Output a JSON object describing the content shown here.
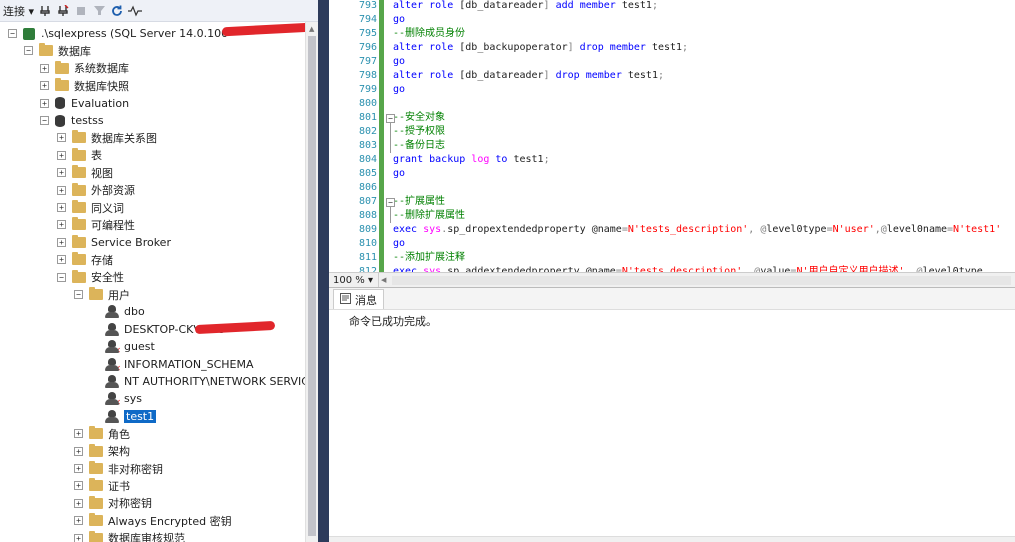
{
  "object_explorer": {
    "toolbar": {
      "connect_label": "连接 ▾"
    },
    "tree": [
      {
        "label": ".\\sqlexpress (SQL Server 14.0.100",
        "icon": "server-icon"
      },
      {
        "label": "数据库",
        "icon": "folder-icon"
      },
      {
        "label": "系统数据库",
        "icon": "folder-icon"
      },
      {
        "label": "数据库快照",
        "icon": "folder-icon"
      },
      {
        "label": "Evaluation",
        "icon": "database-icon"
      },
      {
        "label": "testss",
        "icon": "database-icon"
      },
      {
        "label": "数据库关系图",
        "icon": "folder-icon"
      },
      {
        "label": "表",
        "icon": "folder-icon"
      },
      {
        "label": "视图",
        "icon": "folder-icon"
      },
      {
        "label": "外部资源",
        "icon": "folder-icon"
      },
      {
        "label": "同义词",
        "icon": "folder-icon"
      },
      {
        "label": "可编程性",
        "icon": "folder-icon"
      },
      {
        "label": "Service Broker",
        "icon": "folder-icon"
      },
      {
        "label": "存储",
        "icon": "folder-icon"
      },
      {
        "label": "安全性",
        "icon": "folder-icon"
      },
      {
        "label": "用户",
        "icon": "folder-icon"
      },
      {
        "label": "dbo",
        "icon": "user-icon"
      },
      {
        "label": "DESKTOP-CKVMU9",
        "icon": "user-icon"
      },
      {
        "label": "guest",
        "icon": "user-disabled-icon"
      },
      {
        "label": "INFORMATION_SCHEMA",
        "icon": "user-disabled-icon"
      },
      {
        "label": "NT AUTHORITY\\NETWORK SERVICE",
        "icon": "user-icon"
      },
      {
        "label": "sys",
        "icon": "user-disabled-icon"
      },
      {
        "label": "test1",
        "icon": "user-icon"
      },
      {
        "label": "角色",
        "icon": "folder-icon"
      },
      {
        "label": "架构",
        "icon": "folder-icon"
      },
      {
        "label": "非对称密钥",
        "icon": "folder-icon"
      },
      {
        "label": "证书",
        "icon": "folder-icon"
      },
      {
        "label": "对称密钥",
        "icon": "folder-icon"
      },
      {
        "label": "Always Encrypted 密钥",
        "icon": "folder-icon"
      },
      {
        "label": "数据库审核规范",
        "icon": "folder-icon"
      }
    ]
  },
  "editor": {
    "lines": [
      {
        "num": "793",
        "text": "alter role [db_datareader] add member test1;"
      },
      {
        "num": "794",
        "text": "go"
      },
      {
        "num": "795",
        "text": "--删除成员身份"
      },
      {
        "num": "796",
        "text": "alter role [db_backupoperator] drop member test1;"
      },
      {
        "num": "797",
        "text": "go"
      },
      {
        "num": "798",
        "text": "alter role [db_datareader] drop member test1;"
      },
      {
        "num": "799",
        "text": "go"
      },
      {
        "num": "800",
        "text": ""
      },
      {
        "num": "801",
        "text": "--安全对象"
      },
      {
        "num": "802",
        "text": "--授予权限"
      },
      {
        "num": "803",
        "text": "--备份日志"
      },
      {
        "num": "804",
        "text": "grant backup log to test1;"
      },
      {
        "num": "805",
        "text": "go"
      },
      {
        "num": "806",
        "text": ""
      },
      {
        "num": "807",
        "text": "--扩展属性"
      },
      {
        "num": "808",
        "text": "--删除扩展属性"
      },
      {
        "num": "809",
        "text": "exec sys.sp_dropextendedproperty @name=N'tests_description', @level0type=N'user',@level0name=N'test1'"
      },
      {
        "num": "810",
        "text": "go"
      },
      {
        "num": "811",
        "text": "--添加扩展注释"
      },
      {
        "num": "812",
        "text": "exec sys.sp_addextendedproperty @name=N'tests_description', @value=N'用户自定义用户描述', @level0type"
      }
    ],
    "zoom": "100 %"
  },
  "results": {
    "tab_label": "消息",
    "message": "命令已成功完成。"
  },
  "colors": {
    "splitter": "#2d3b5b",
    "selection": "#0f6ac7",
    "keyword": "#0000ff",
    "comment": "#008000",
    "string": "#ff0000",
    "function": "#ff00ff",
    "line_number": "#2b91af"
  }
}
